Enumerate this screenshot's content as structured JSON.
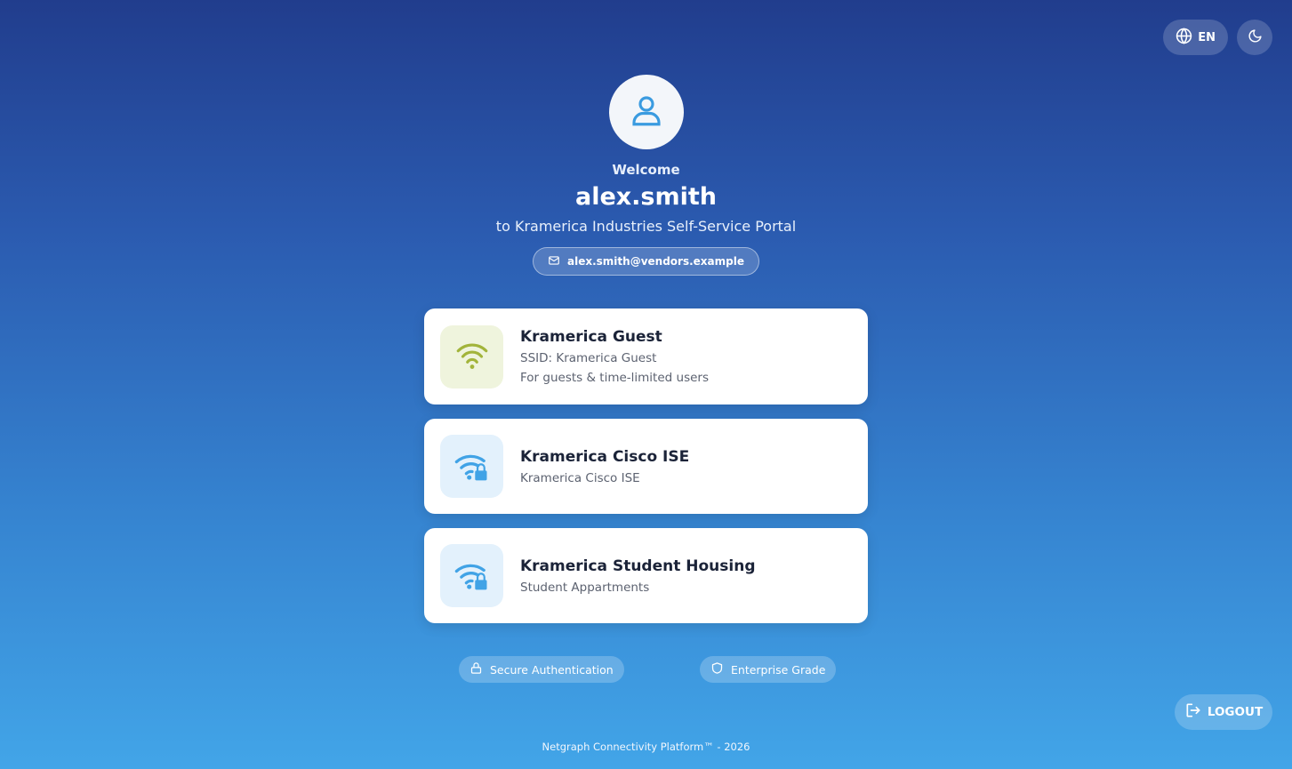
{
  "topbar": {
    "language_label": "EN",
    "language_icon": "globe-icon",
    "theme_icon": "moon-icon"
  },
  "header": {
    "avatar_icon": "user-icon",
    "welcome": "Welcome",
    "username": "alex.smith",
    "subtitle": "to Kramerica Industries Self-Service Portal",
    "email": "alex.smith@vendors.example",
    "email_icon": "mail-icon"
  },
  "networks": [
    {
      "title": "Kramerica Guest",
      "lines": [
        "SSID: Kramerica Guest",
        "For guests & time-limited users"
      ],
      "icon": "wifi-icon",
      "icon_color": "#a2b43a"
    },
    {
      "title": "Kramerica Cisco ISE",
      "lines": [
        "Kramerica Cisco ISE"
      ],
      "icon": "wifi-lock-icon",
      "icon_color": "#41a3e6"
    },
    {
      "title": "Kramerica Student Housing",
      "lines": [
        "Student Appartments"
      ],
      "icon": "wifi-lock-icon",
      "icon_color": "#41a3e6"
    }
  ],
  "badges": [
    {
      "label": "Secure Authentication",
      "icon": "lock-icon"
    },
    {
      "label": "Enterprise Grade",
      "icon": "shield-icon"
    }
  ],
  "logout": {
    "label": "LOGOUT",
    "icon": "logout-icon"
  },
  "footer": {
    "text": "Netgraph Connectivity Platform™ - 2026"
  }
}
